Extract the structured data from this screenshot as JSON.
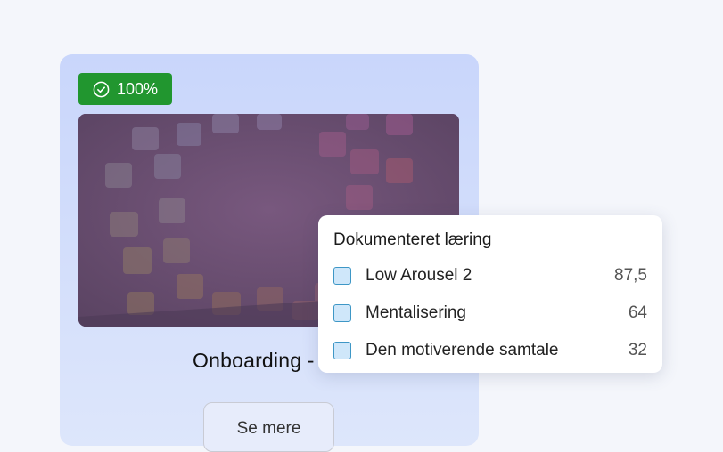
{
  "course_card": {
    "progress_badge": "100%",
    "title": "Onboarding - før",
    "see_more_label": "Se mere"
  },
  "popup": {
    "title": "Dokumenteret læring",
    "items": [
      {
        "label": "Low Arousel 2",
        "value": "87,5"
      },
      {
        "label": "Mentalisering",
        "value": "64"
      },
      {
        "label": "Den motiverende samtale",
        "value": "32"
      }
    ]
  },
  "colors": {
    "badge": "#21962f",
    "card": "#c9d6fb",
    "checkbox_border": "#3e97c6"
  }
}
